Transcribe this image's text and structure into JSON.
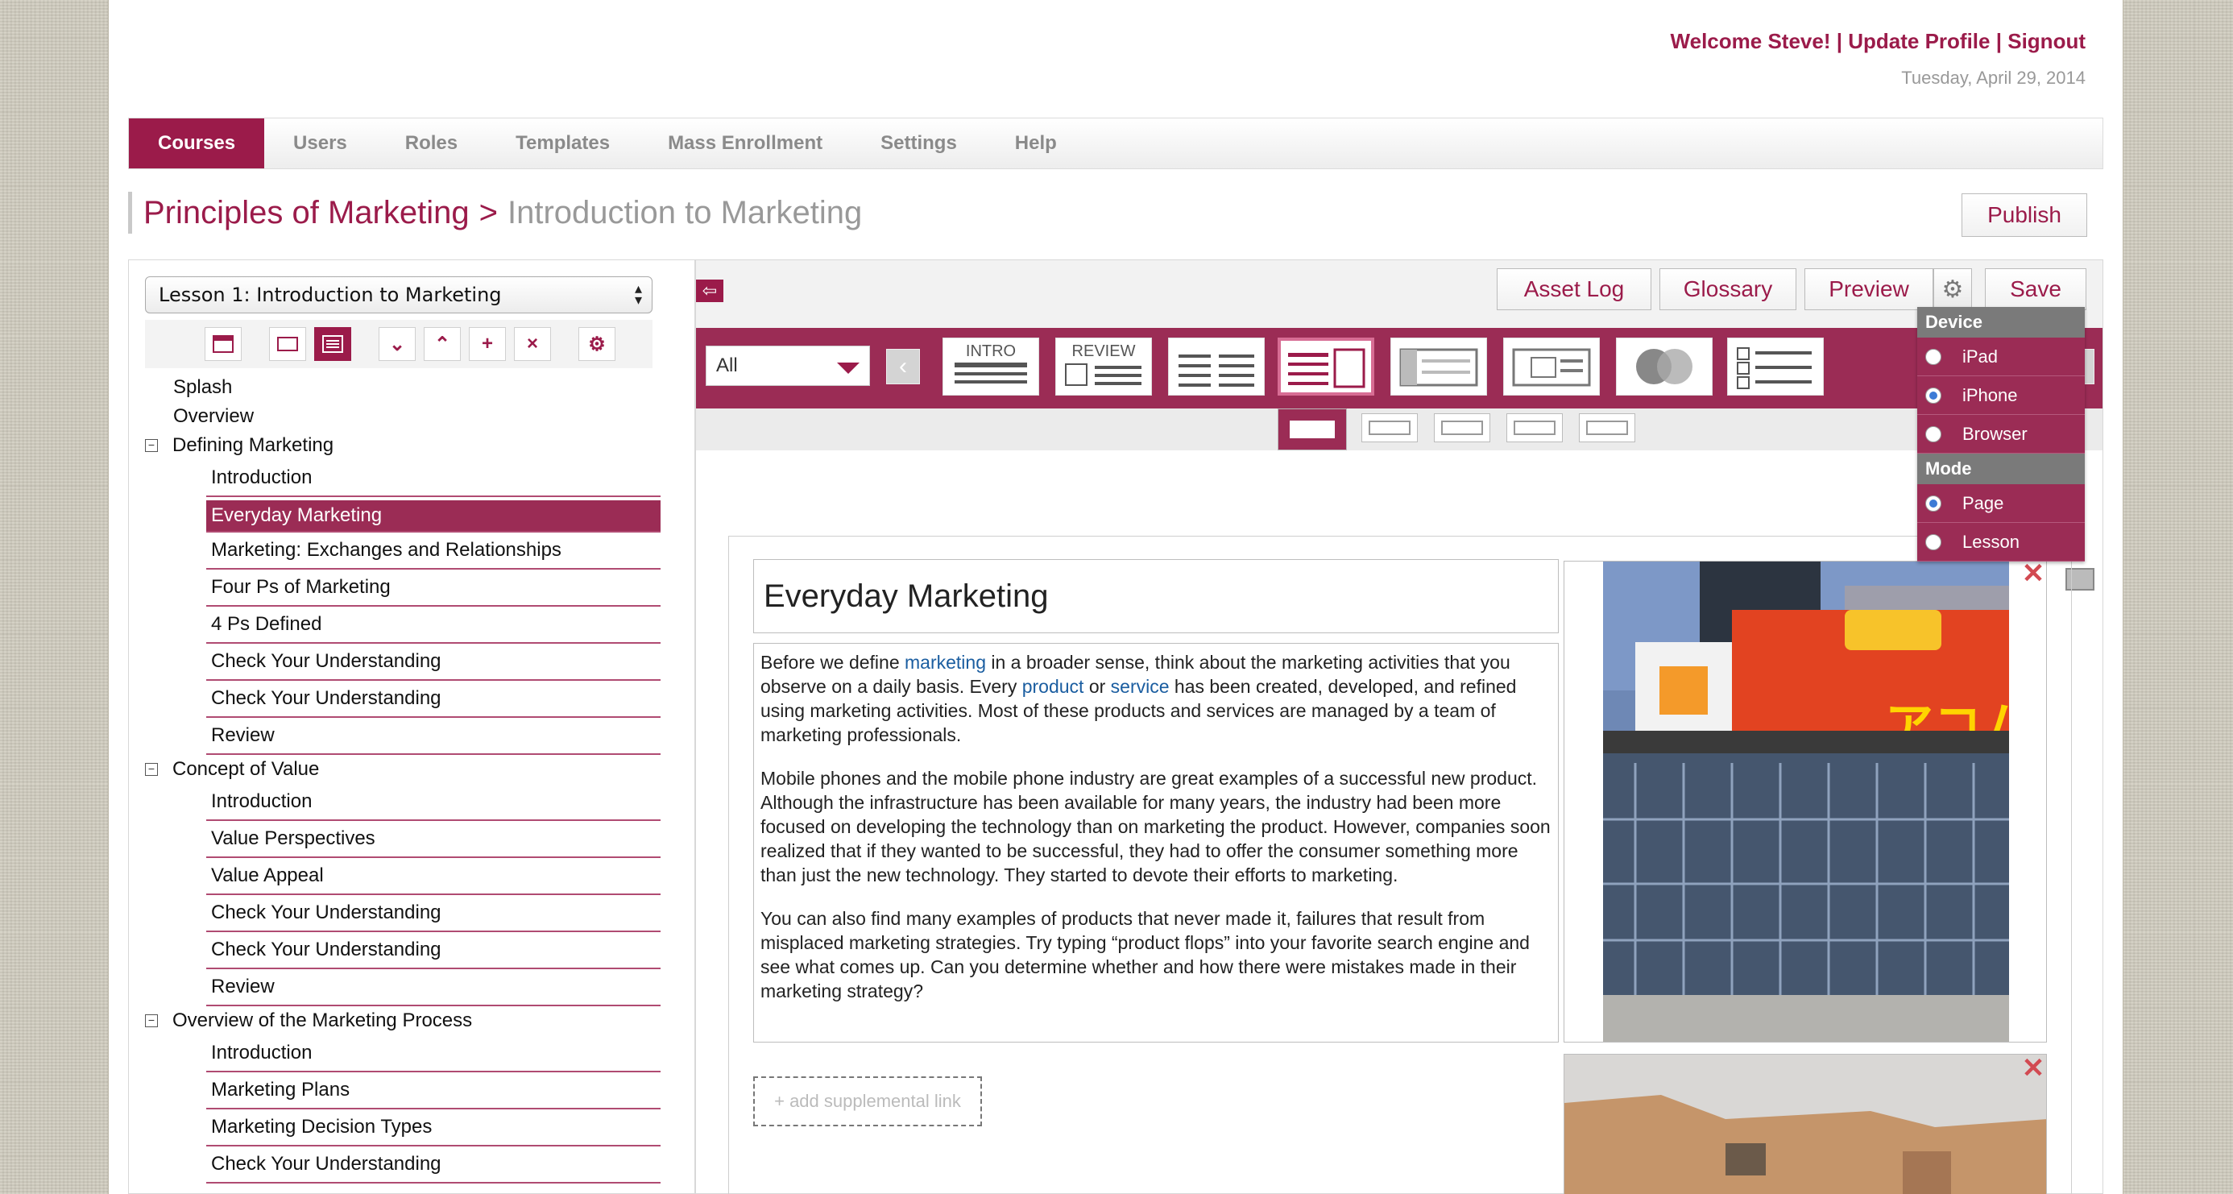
{
  "header": {
    "welcome": "Welcome Steve!",
    "update_profile": "Update Profile",
    "signout": "Signout",
    "separator": "|",
    "date": "Tuesday, April 29, 2014"
  },
  "nav": {
    "items": [
      "Courses",
      "Users",
      "Roles",
      "Templates",
      "Mass Enrollment",
      "Settings",
      "Help"
    ],
    "active": "Courses"
  },
  "title": {
    "course": "Principles of Marketing",
    "separator": ">",
    "lesson": "Introduction to Marketing"
  },
  "publish_label": "Publish",
  "lesson_select": {
    "value": "Lesson 1: Introduction to Marketing"
  },
  "toolbar_icons": [
    "page-layout-icon",
    "page-outline-icon",
    "list-layout-icon",
    "move-down-icon",
    "move-up-icon",
    "add-icon",
    "delete-icon",
    "settings-gear-icon"
  ],
  "tree": {
    "top_items": [
      "Splash",
      "Overview"
    ],
    "sections": [
      {
        "label": "Defining Marketing",
        "collapse_symbol": "−",
        "items": [
          "Introduction",
          "Everyday Marketing",
          "Marketing: Exchanges and Relationships",
          "Four Ps of Marketing",
          "4 Ps Defined",
          "Check Your Understanding",
          "Check Your Understanding",
          "Review"
        ]
      },
      {
        "label": "Concept of Value",
        "collapse_symbol": "−",
        "items": [
          "Introduction",
          "Value Perspectives",
          "Value Appeal",
          "Check Your Understanding",
          "Check Your Understanding",
          "Review"
        ]
      },
      {
        "label": "Overview of the Marketing Process",
        "collapse_symbol": "−",
        "items": [
          "Introduction",
          "Marketing Plans",
          "Marketing Decision Types",
          "Check Your Understanding"
        ]
      }
    ],
    "selected": "Everyday Marketing"
  },
  "editor": {
    "buttons": {
      "asset_log": "Asset Log",
      "glossary": "Glossary",
      "preview": "Preview",
      "save": "Save"
    },
    "filter": {
      "value": "All"
    },
    "templates": [
      "INTRO",
      "REVIEW",
      "",
      "",
      "",
      "",
      "",
      ""
    ],
    "dropdown": {
      "device_header": "Device",
      "devices": [
        "iPad",
        "iPhone",
        "Browser"
      ],
      "device_selected": "iPhone",
      "mode_header": "Mode",
      "modes": [
        "Page",
        "Lesson"
      ],
      "mode_selected": "Page"
    }
  },
  "content": {
    "page_title": "Everyday Marketing",
    "p1_a": "Before we define ",
    "p1_link1": "marketing",
    "p1_b": " in a broader sense, think about the marketing activities that you observe on a daily basis. Every ",
    "p1_link2": "product",
    "p1_c": " or ",
    "p1_link3": "service",
    "p1_d": " has been created, developed, and refined using marketing activities. Most of these products and services are managed by a team of marketing professionals.",
    "p2": "Mobile phones and the mobile phone industry are great examples of a successful new product. Although the infrastructure has been available for many years, the industry had been more focused on developing the technology than on marketing the product. However, companies soon realized that if they wanted to be successful, they had to offer the consumer something more than just the new technology. They started to devote their efforts to marketing.",
    "p3": "You can also find many examples of products that never made it, failures that result from misplaced marketing strategies. Try typing “product flops” into your favorite search engine and see what comes up. Can you determine whether and how there were mistakes made in their marketing strategy?",
    "supplemental_link": "+ add supplemental link",
    "image1_sign_text": "アコム",
    "close_symbol": "✕"
  },
  "colors": {
    "brand": "#9b1b4a",
    "link": "#1a5da0"
  }
}
